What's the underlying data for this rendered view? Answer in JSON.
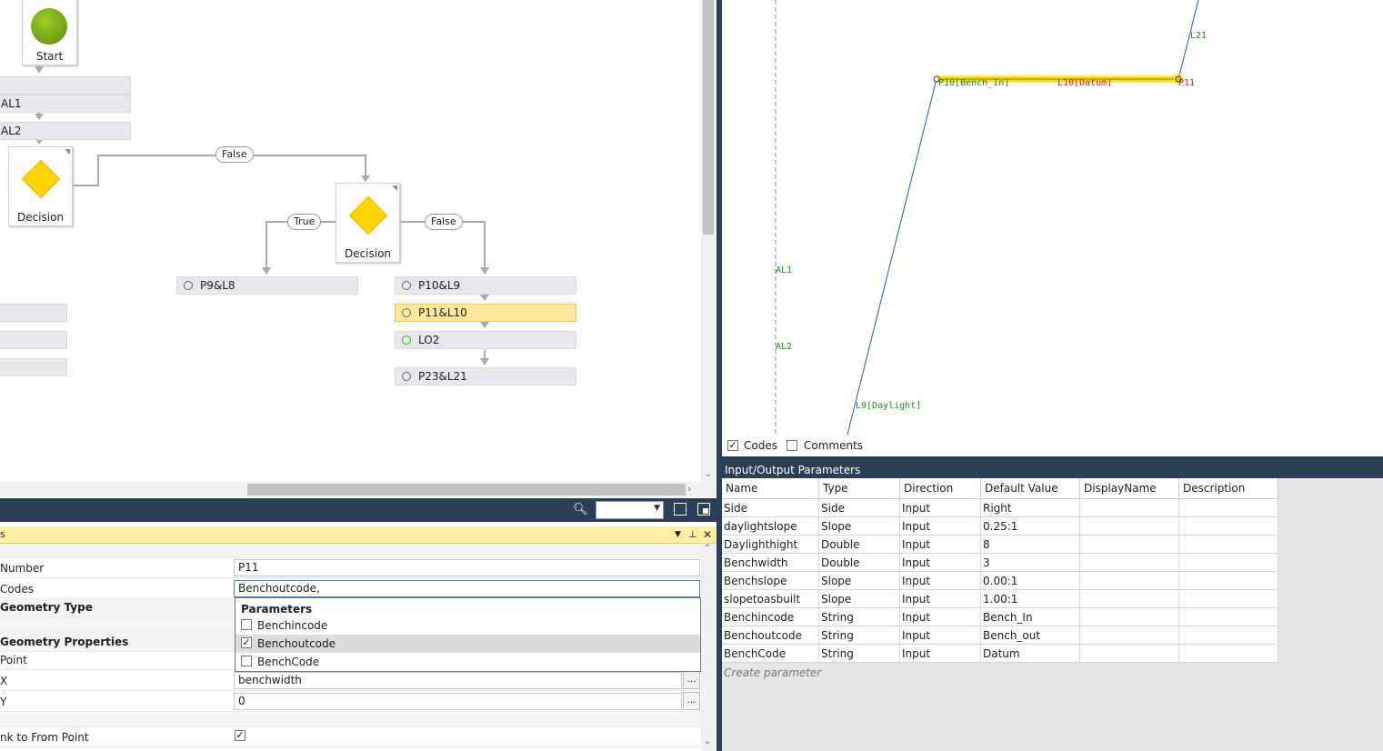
{
  "flowchart": {
    "start_label": "Start",
    "al1_label": "AL1",
    "al2_label": "AL2",
    "decision1_label": "Decision",
    "decision2_label": "Decision",
    "false_tag_1": "False",
    "true_tag": "True",
    "false_tag_2": "False",
    "steps": [
      {
        "label": "P9&L8"
      },
      {
        "label": "P10&L9"
      },
      {
        "label": "P11&L10"
      },
      {
        "label": "LO2"
      },
      {
        "label": "P23&L21"
      }
    ]
  },
  "properties": {
    "title": "s",
    "rows": {
      "number_label": "Number",
      "number_value": "P11",
      "codes_label": "Codes",
      "codes_value": "Benchoutcode,",
      "geometry_type_label": "Geometry Type",
      "geometry_props_label": "Geometry Properties",
      "point_label": "Point",
      "x_label": "X",
      "x_value": "benchwidth",
      "y_label": "Y",
      "y_value": "0",
      "link_label": "nk to From Point",
      "ellipsis": "..."
    },
    "dropdown": {
      "header": "Parameters",
      "items": [
        {
          "label": "Benchincode",
          "checked": false
        },
        {
          "label": "Benchoutcode",
          "checked": true
        },
        {
          "label": "BenchCode",
          "checked": false
        }
      ]
    }
  },
  "canvas": {
    "labels": {
      "l21": "L21",
      "p10": "P10[Bench_In]",
      "l10": "L10[Datum]",
      "p11": "P11",
      "al1": "AL1",
      "al2": "AL2",
      "l9": "L9[Daylight]"
    },
    "codes_checkbox": "Codes",
    "comments_checkbox": "Comments"
  },
  "io_params": {
    "title": "Input/Output Parameters",
    "columns": [
      "Name",
      "Type",
      "Direction",
      "Default Value",
      "DisplayName",
      "Description"
    ],
    "rows": [
      [
        "Side",
        "Side",
        "Input",
        "Right",
        "",
        ""
      ],
      [
        "daylightslope",
        "Slope",
        "Input",
        "0.25:1",
        "",
        ""
      ],
      [
        "Daylighthight",
        "Double",
        "Input",
        "8",
        "",
        ""
      ],
      [
        "Benchwidth",
        "Double",
        "Input",
        "3",
        "",
        ""
      ],
      [
        "Benchslope",
        "Slope",
        "Input",
        "0.00:1",
        "",
        ""
      ],
      [
        "slopetoasbuilt",
        "Slope",
        "Input",
        "1.00:1",
        "",
        ""
      ],
      [
        "Benchincode",
        "String",
        "Input",
        "Bench_In",
        "",
        ""
      ],
      [
        "Benchoutcode",
        "String",
        "Input",
        "Bench_out",
        "",
        ""
      ],
      [
        "BenchCode",
        "String",
        "Input",
        "Datum",
        "",
        ""
      ]
    ],
    "create_placeholder": "Create parameter"
  },
  "colors": {
    "dark_panel": "#2d3e57",
    "selected_step": "#fde89f",
    "highlight_line": "#ffe000",
    "line_blue": "#2b4fcf",
    "label_green": "#1e8a1e",
    "label_red": "#d0201e"
  }
}
